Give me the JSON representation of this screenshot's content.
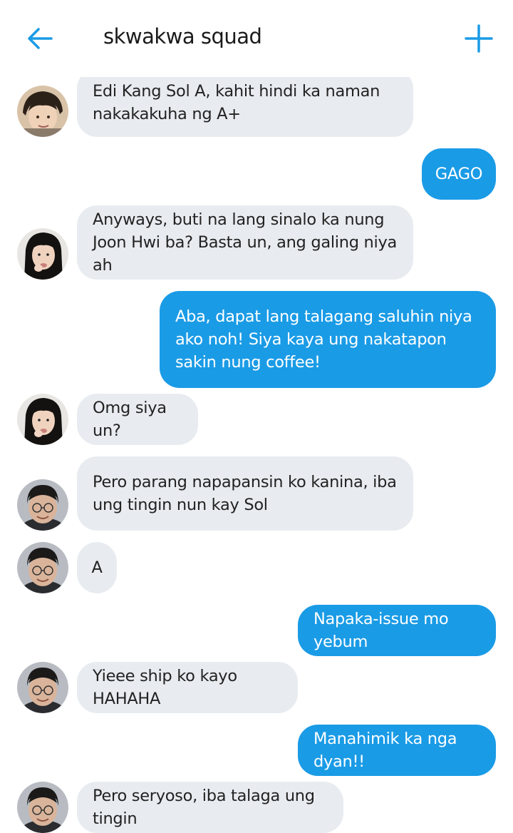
{
  "header": {
    "title": "skwakwa squad",
    "back_icon": "arrow-left-icon",
    "add_icon": "plus-icon",
    "accent": "#1a9be6"
  },
  "colors": {
    "incoming_bubble": "#e8ecf0",
    "outgoing_bubble": "#1a9be6"
  },
  "messages": [
    {
      "side": "in",
      "avatar": "girl-short-hair",
      "text": "Edi Kang Sol A, kahit hindi ka naman nakakakuha ng A+"
    },
    {
      "side": "out",
      "text": "GAGO"
    },
    {
      "side": "in",
      "avatar": "girl-long-hair",
      "text": "Anyways, buti na lang sinalo ka nung Joon Hwi ba? Basta un, ang galing niya ah"
    },
    {
      "side": "out",
      "text": "Aba, dapat lang talagang saluhin niya ako noh! Siya kaya ung nakatapon sakin nung coffee!"
    },
    {
      "side": "in",
      "avatar": "girl-long-hair",
      "text": "Omg siya un?"
    },
    {
      "side": "in",
      "avatar": "guy-glasses",
      "text": "Pero parang napapansin ko kanina, iba ung tingin nun kay Sol"
    },
    {
      "side": "in",
      "avatar": "guy-glasses",
      "text": "A"
    },
    {
      "side": "out",
      "text": "Napaka-issue mo yebum"
    },
    {
      "side": "in",
      "avatar": "guy-glasses",
      "text": "Yieee ship ko kayo HAHAHA"
    },
    {
      "side": "out",
      "text": "Manahimik ka nga dyan!!"
    },
    {
      "side": "in",
      "avatar": "guy-glasses",
      "text": "Pero seryoso, iba talaga ung tingin"
    }
  ]
}
